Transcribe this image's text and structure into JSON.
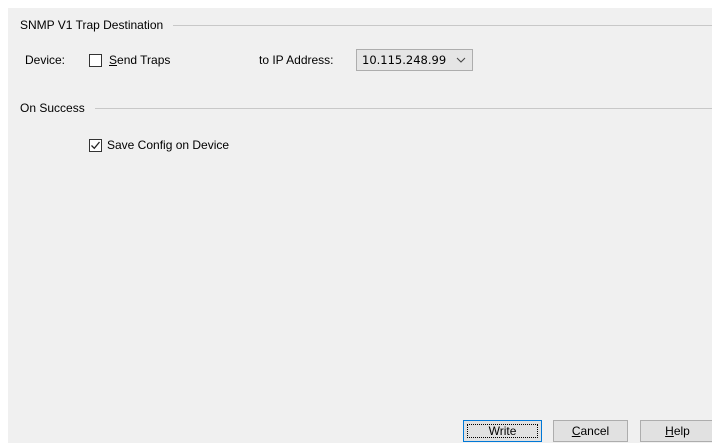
{
  "trap_group": {
    "title": "SNMP V1 Trap Destination",
    "device_label": "Device:",
    "send_traps_checked": false,
    "send_traps_label": "Send Traps",
    "ip_label": "to IP Address:",
    "ip_value": "10.115.248.99",
    "dropdown_icon": "chevron-down-icon"
  },
  "success_group": {
    "title": "On Success",
    "save_config_checked": true,
    "save_config_label": "Save Config on Device"
  },
  "buttons": {
    "write": "Write",
    "cancel": "Cancel",
    "help": "Help"
  },
  "colors": {
    "panel_bg": "#f0f0f0",
    "default_button_border": "#0078d7"
  }
}
